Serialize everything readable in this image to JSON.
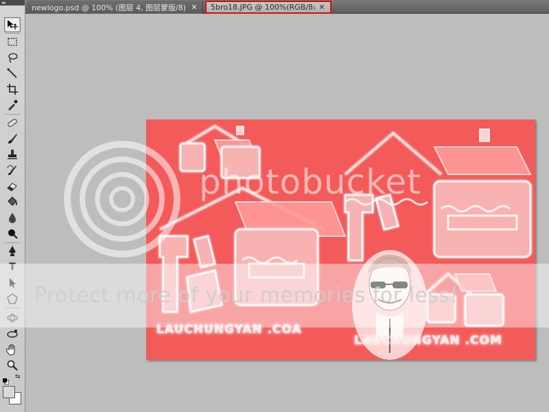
{
  "tabs": [
    {
      "label": "newlogo.psd @ 100% (图层 4, 图层蒙版/8) *",
      "close": "✕",
      "active": false
    },
    {
      "label": "5bro18.JPG @ 100%(RGB/8#)",
      "close": "✕",
      "active": true
    }
  ],
  "toolbox": {
    "grip": "▸▸",
    "tools": [
      {
        "name": "move-tool-icon",
        "active": true
      },
      {
        "name": "marquee-tool-icon"
      },
      {
        "name": "lasso-tool-icon"
      },
      {
        "name": "magic-wand-tool-icon"
      },
      {
        "name": "crop-tool-icon"
      },
      {
        "name": "eyedropper-tool-icon"
      },
      {
        "name": "healing-brush-tool-icon"
      },
      {
        "name": "brush-tool-icon"
      },
      {
        "name": "clone-stamp-tool-icon"
      },
      {
        "name": "history-brush-tool-icon"
      },
      {
        "name": "eraser-tool-icon"
      },
      {
        "name": "paint-bucket-tool-icon"
      },
      {
        "name": "blur-tool-icon"
      },
      {
        "name": "dodge-tool-icon"
      },
      {
        "name": "pen-tool-icon"
      },
      {
        "name": "type-tool-icon",
        "glyph": "T"
      },
      {
        "name": "path-selection-tool-icon"
      },
      {
        "name": "shape-tool-icon"
      },
      {
        "name": "3d-rotate-tool-icon"
      },
      {
        "name": "3d-orbit-tool-icon"
      },
      {
        "name": "hand-tool-icon"
      },
      {
        "name": "zoom-tool-icon"
      }
    ],
    "foreground_color": "#d8d8d8",
    "background_color": "#ffffff"
  },
  "document": {
    "background_color": "#f35a5a",
    "domain_left": "LAUCHUNGYAN .COA",
    "domain_right": "LAUCHUNGYAN .COM"
  },
  "watermark": {
    "logo_text": "photobucket",
    "protect_text": "Protect more of your memories for less!"
  }
}
